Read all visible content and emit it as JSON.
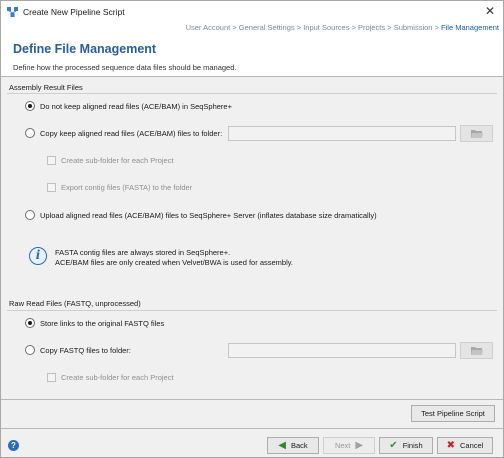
{
  "window": {
    "title": "Create New Pipeline Script",
    "close_glyph": "✕"
  },
  "breadcrumb": {
    "steps": [
      "User Account",
      "General Settings",
      "Input Sources",
      "Projects",
      "Submission",
      "File Management"
    ],
    "separator": " > ",
    "active_index": 5
  },
  "header": {
    "title": "Define File Management",
    "subtitle": "Define how the processed sequence data files should be managed."
  },
  "assembly": {
    "section_title": "Assembly Result Files",
    "opt_no_keep": "Do not keep aligned read files (ACE/BAM) in SeqSphere+",
    "opt_copy_keep": "Copy keep aligned read files (ACE/BAM) files to folder:",
    "copy_path_value": "",
    "chk_subfolder": "Create sub-folder for each Project",
    "chk_export_contig": "Export contig files (FASTA) to the folder",
    "opt_upload": "Upload aligned read files (ACE/BAM) files to SeqSphere+ Server (inflates database size dramatically)",
    "selected": "no_keep",
    "info_line1": "FASTA contig files are always stored in SeqSphere+.",
    "info_line2": "ACE/BAM files are only created when Velvet/BWA is used for assembly."
  },
  "raw": {
    "section_title": "Raw Read Files (FASTQ, unprocessed)",
    "opt_store_links": "Store links to the original FASTQ files",
    "opt_copy": "Copy FASTQ files to folder:",
    "copy_path_value": "",
    "chk_subfolder": "Create sub-folder for each Project",
    "selected": "store_links"
  },
  "buttons": {
    "test": "Test Pipeline Script",
    "back": "Back",
    "next": "Next",
    "finish": "Finish",
    "cancel": "Cancel"
  },
  "colors": {
    "accent": "#2a5d9c",
    "breadcrumb_active": "#1e5ba8",
    "back_arrow": "#2d8a2d",
    "finish_check": "#2d9a2d",
    "cancel_x": "#cc2222",
    "info": "#2a6bc1"
  },
  "icons": {
    "app": "pipeline-app-icon",
    "browse": "folder-icon",
    "info": "info-icon",
    "help": "help-icon",
    "back": "back-arrow-icon",
    "next": "next-arrow-icon",
    "finish": "checkmark-icon",
    "cancel": "cancel-x-icon"
  }
}
